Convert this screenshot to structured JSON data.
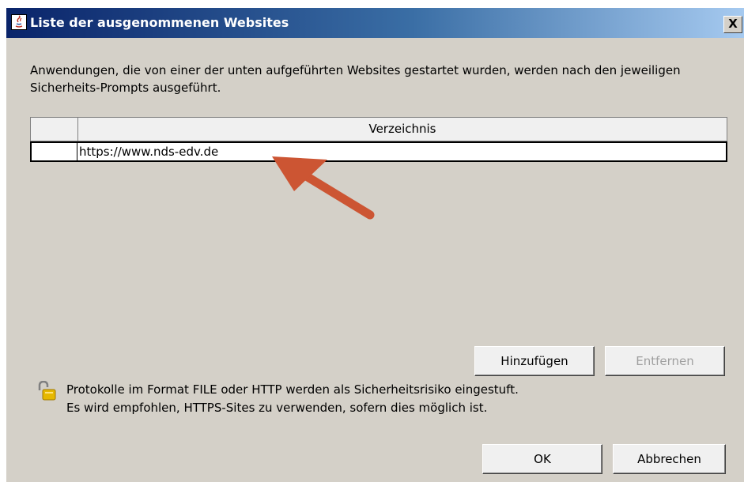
{
  "window": {
    "title": "Liste der ausgenommenen Websites",
    "close_label": "X"
  },
  "description": "Anwendungen, die von einer der unten aufgeführten Websites gestartet wurden, werden nach den jeweiligen Sicherheits-Prompts ausgeführt.",
  "table": {
    "columns": [
      "",
      "Verzeichnis"
    ],
    "rows": [
      {
        "index": "",
        "url": "https://www.nds-edv.de"
      }
    ]
  },
  "buttons": {
    "add": "Hinzufügen",
    "remove": "Entfernen",
    "ok": "OK",
    "cancel": "Abbrechen"
  },
  "info": {
    "line1": "Protokolle im Format FILE oder HTTP werden als Sicherheitsrisiko eingestuft.",
    "line2": "Es wird empfohlen, HTTPS-Sites zu verwenden, sofern dies möglich ist."
  },
  "icons": {
    "title": "java-icon",
    "info": "unlocked-padlock-icon",
    "annotation": "red-arrow-annotation"
  },
  "colors": {
    "titlebar_start": "#0a246a",
    "titlebar_end": "#a6caf0",
    "dialog_bg": "#d4d0c8",
    "arrow": "#cc5533"
  }
}
